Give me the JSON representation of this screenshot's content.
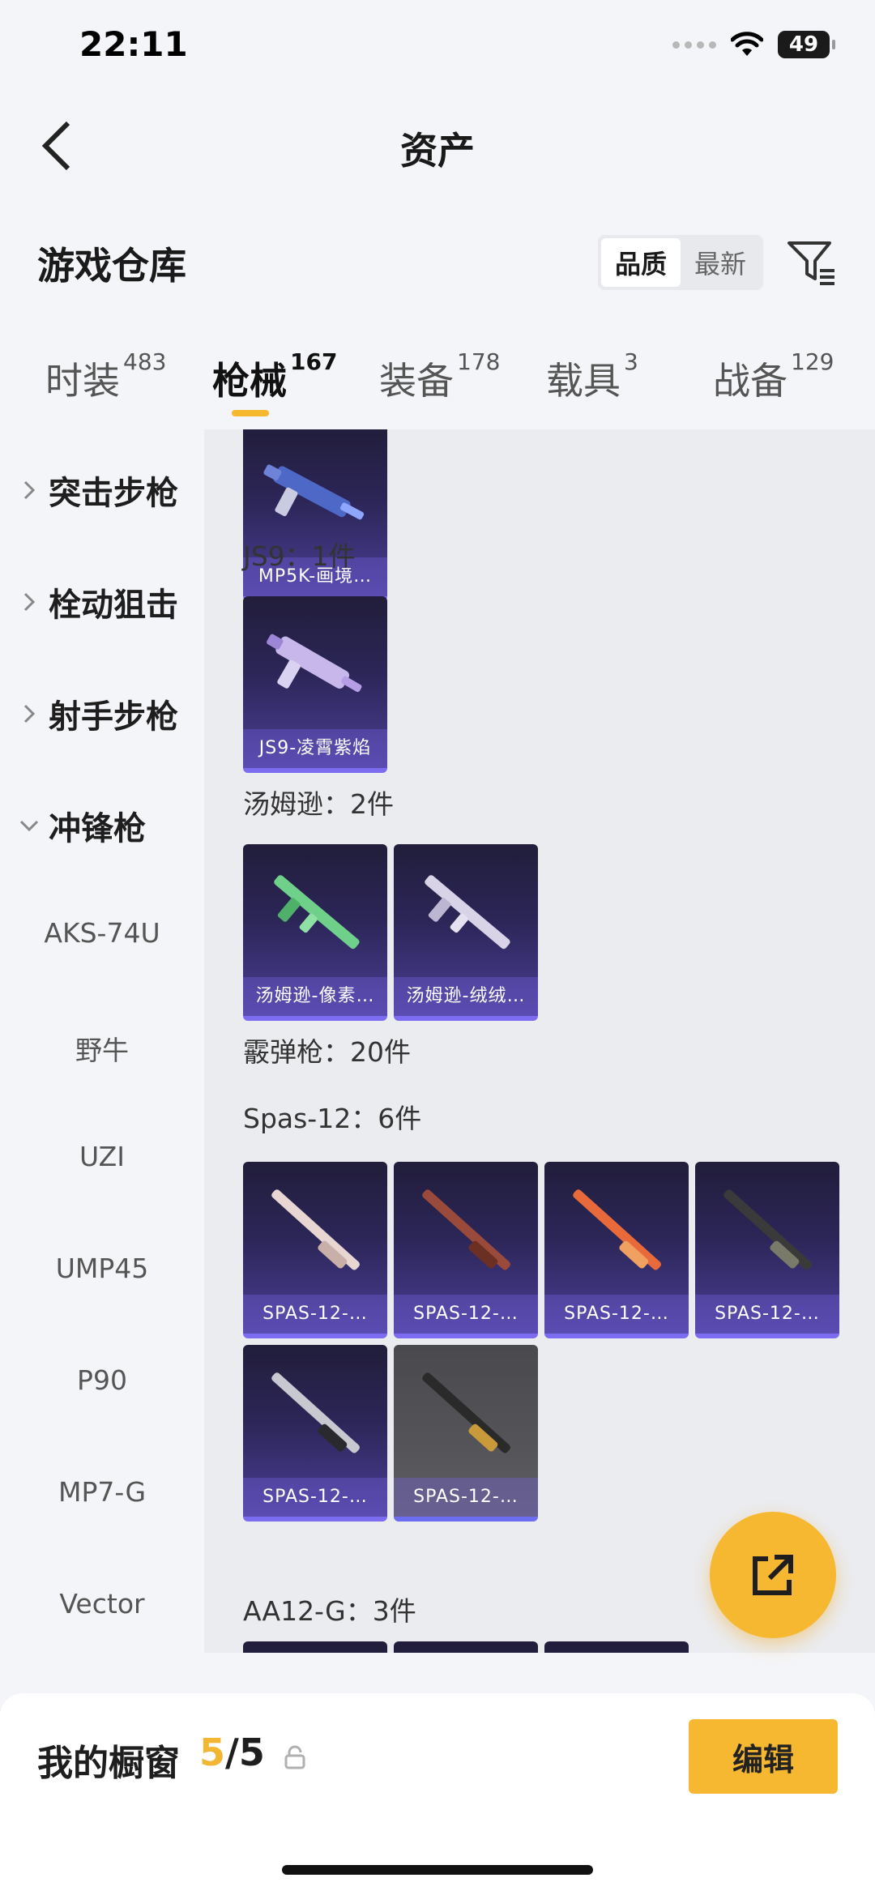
{
  "status": {
    "time": "22:11",
    "battery": "49"
  },
  "nav": {
    "title": "资产"
  },
  "header": {
    "section_title": "游戏仓库",
    "sort_options": [
      "品质",
      "最新"
    ],
    "active_sort": "品质"
  },
  "tabs": [
    {
      "label": "时装",
      "count": "483"
    },
    {
      "label": "枪械",
      "count": "167",
      "active": true
    },
    {
      "label": "装备",
      "count": "178"
    },
    {
      "label": "载具",
      "count": "3"
    },
    {
      "label": "战备",
      "count": "129"
    }
  ],
  "sidebar": {
    "groups": [
      "突击步枪",
      "栓动狙击",
      "射手步枪",
      "冲锋枪"
    ],
    "subitems": [
      "AKS-74U",
      "野牛",
      "UZI",
      "UMP45",
      "P90",
      "MP7-G",
      "Vector"
    ]
  },
  "content": {
    "top_card_label": "MP5K-画境…",
    "groups": [
      {
        "title": "JS9：1件",
        "cards": [
          "JS9-凌霄紫焰"
        ]
      },
      {
        "title": "汤姆逊：2件",
        "cards": [
          "汤姆逊-像素…",
          "汤姆逊-绒绒…"
        ]
      },
      {
        "title": "霰弹枪：20件"
      },
      {
        "title": "Spas-12：6件",
        "cards": [
          "SPAS-12-…",
          "SPAS-12-…",
          "SPAS-12-…",
          "SPAS-12-…",
          "SPAS-12-…",
          "SPAS-12-…"
        ]
      },
      {
        "title": "AA12-G：3件"
      }
    ]
  },
  "bottom": {
    "showcase_label": "我的橱窗",
    "showcase_current": "5",
    "showcase_total": "/5",
    "edit_label": "编辑"
  },
  "colors": {
    "accent": "#f6b731",
    "card_purple": "#4a3f96"
  }
}
